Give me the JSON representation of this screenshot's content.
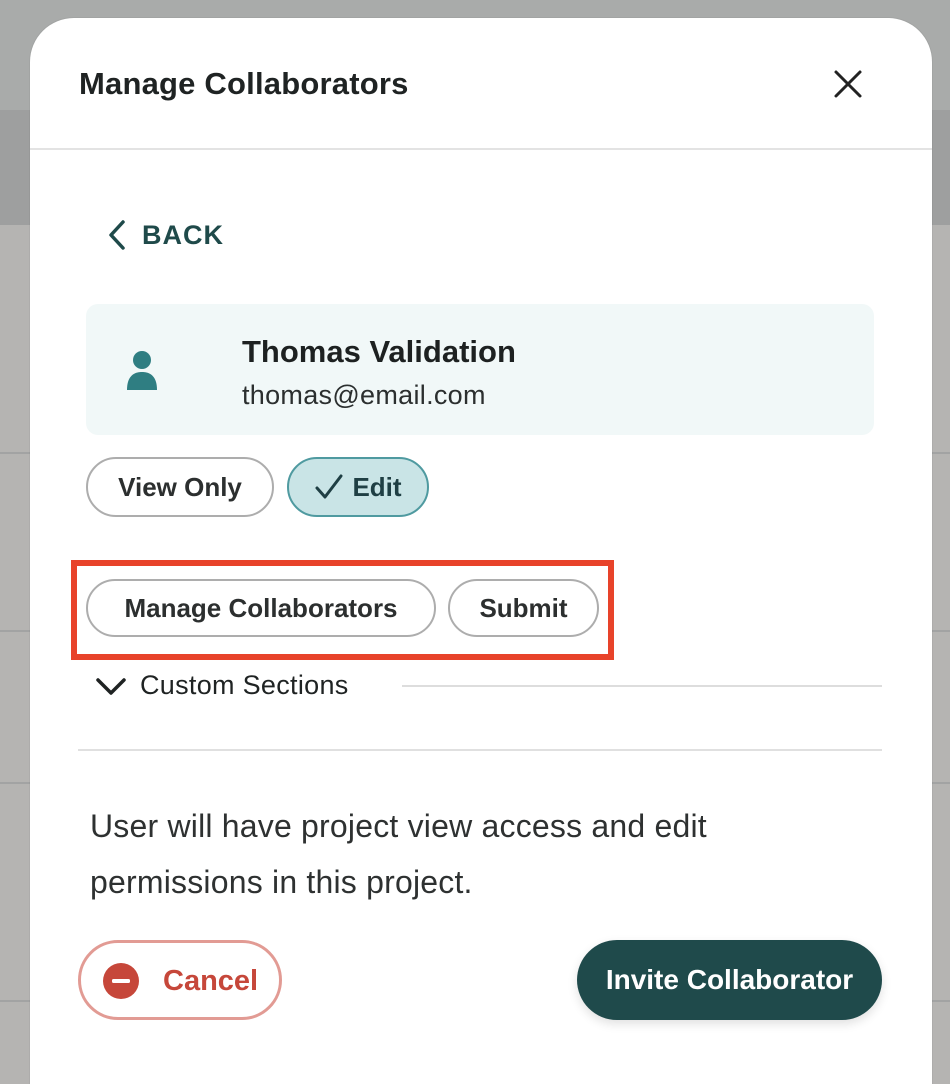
{
  "modal": {
    "title": "Manage Collaborators"
  },
  "back": {
    "label": "BACK"
  },
  "user": {
    "name": "Thomas Validation",
    "email": "thomas@email.com"
  },
  "permissions": {
    "view_only_label": "View Only",
    "edit_label": "Edit",
    "selected": "Edit"
  },
  "actions": {
    "manage_collaborators_label": "Manage Collaborators",
    "submit_label": "Submit"
  },
  "custom_sections": {
    "label": "Custom Sections",
    "expanded": false
  },
  "description": "User will have project view access and edit permissions in this project.",
  "footer": {
    "cancel_label": "Cancel",
    "invite_label": "Invite Collaborator"
  },
  "colors": {
    "primary": "#1f4a4b",
    "edit_selected_bg": "#c9e4e6",
    "edit_selected_border": "#4f9aa0",
    "cancel": "#c6473a",
    "highlight": "#e8432a",
    "card_bg": "#f1f8f8"
  }
}
